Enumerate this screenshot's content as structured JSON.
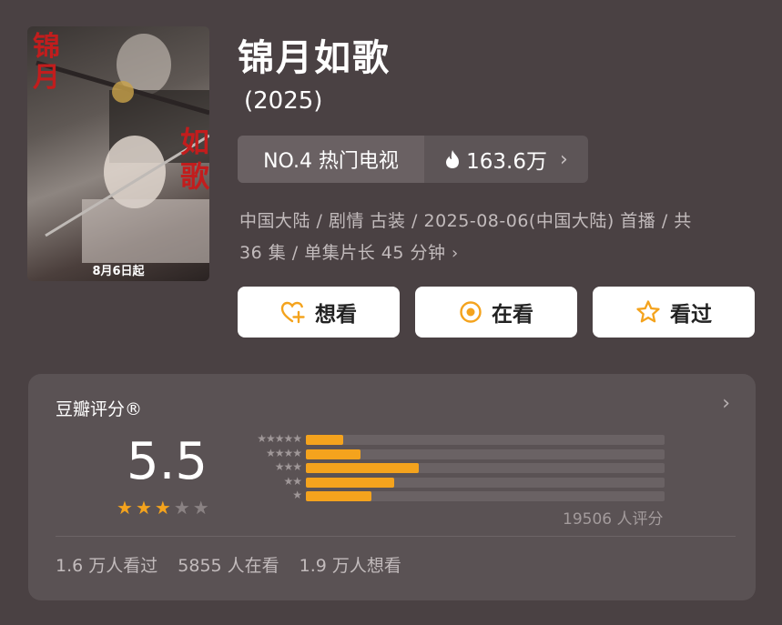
{
  "poster": {
    "title_chars_left": "锦\n月",
    "title_chars_right": "如\n歌",
    "air_date_text": "8月6日起"
  },
  "title": "锦月如歌",
  "year": "(2025)",
  "rank": {
    "label": "NO.4 热门电视",
    "heat": "163.6万"
  },
  "meta": {
    "line1": "中国大陆 / 剧情 古装 / 2025-08-06(中国大陆) 首播 / 共",
    "line2": "36 集 / 单集片长 45 分钟"
  },
  "actions": {
    "want": "想看",
    "watching": "在看",
    "watched": "看过"
  },
  "rating": {
    "header": "豆瓣评分®",
    "score": "5.5",
    "stars_filled": 3,
    "stars_total": 5,
    "distribution": [
      {
        "stars": "★★★★★",
        "fraction": 0.104
      },
      {
        "stars": "★★★★",
        "fraction": 0.152
      },
      {
        "stars": "★★★",
        "fraction": 0.315
      },
      {
        "stars": "★★",
        "fraction": 0.246
      },
      {
        "stars": "★",
        "fraction": 0.183
      }
    ],
    "votes": "19506 人评分",
    "stats": [
      "1.6 万人看过",
      "5855 人在看",
      "1.9 万人想看"
    ]
  },
  "colors": {
    "background": "#4a4143",
    "card": "#5a5254",
    "accent": "#f4a31d"
  }
}
